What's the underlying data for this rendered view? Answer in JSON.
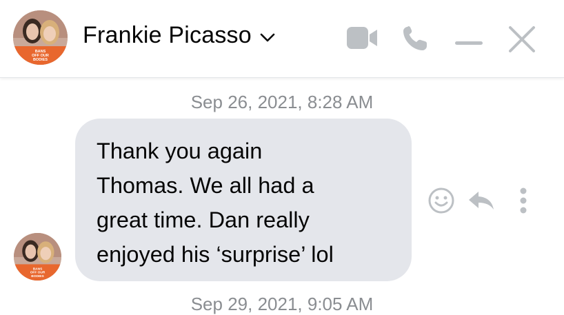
{
  "header": {
    "contact_name": "Frankie Picasso",
    "avatar_badge_lines": [
      "BANS",
      "OFF OUR",
      "BODIES"
    ],
    "icons": [
      "chevron-down-icon",
      "video-call-icon",
      "phone-icon",
      "minimize-icon",
      "close-icon"
    ]
  },
  "messages": [
    {
      "timestamp": "Sep 26, 2021, 8:28 AM",
      "sender_avatar": "avatar",
      "lines": [
        "Thank you again",
        "Thomas. We all had a",
        "great time. Dan really",
        "enjoyed his ‘surprise’ lol"
      ],
      "actions": [
        "react-icon",
        "reply-icon",
        "more-options-icon"
      ]
    }
  ],
  "next_timestamp": "Sep 29, 2021, 9:05 AM",
  "colors": {
    "bubble": "#e4e6eb",
    "icon_gray": "#bcc0c4",
    "timestamp": "#8a8d91",
    "badge_orange": "#e8672e"
  }
}
